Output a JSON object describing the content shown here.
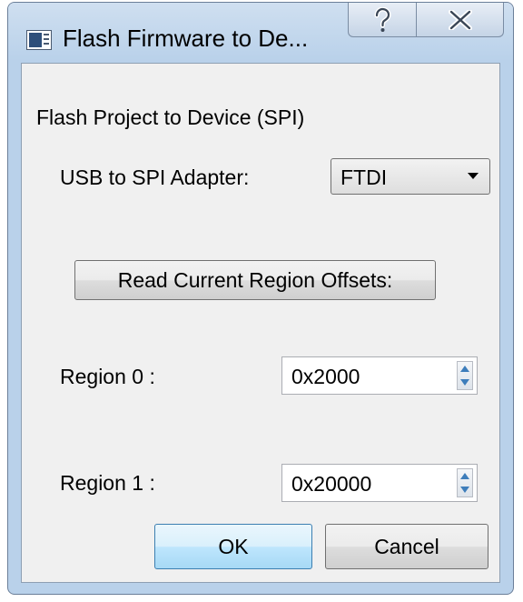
{
  "window": {
    "title": "Flash Firmware to De...",
    "help_glyph": "?",
    "close_glyph": "X"
  },
  "dialog": {
    "heading": "Flash Project to Device (SPI)",
    "adapter": {
      "label": "USB to SPI Adapter:",
      "selected": "FTDI"
    },
    "read_button": "Read Current Region Offsets:",
    "region0": {
      "label": "Region 0 :",
      "value": "0x2000"
    },
    "region1": {
      "label": "Region 1 :",
      "value": "0x20000"
    },
    "ok_button": "OK",
    "cancel_button": "Cancel"
  },
  "icons": {
    "app": "window-app-icon",
    "help": "help-icon",
    "close": "close-icon",
    "dropdown": "chevron-down-icon",
    "spin_up": "spin-up-icon",
    "spin_down": "spin-down-icon"
  },
  "colors": {
    "frame": "#b9d1ea",
    "client": "#f0f0f0",
    "spin_arrow": "#3d7dbb",
    "default_button_border": "#3c7fb1"
  }
}
